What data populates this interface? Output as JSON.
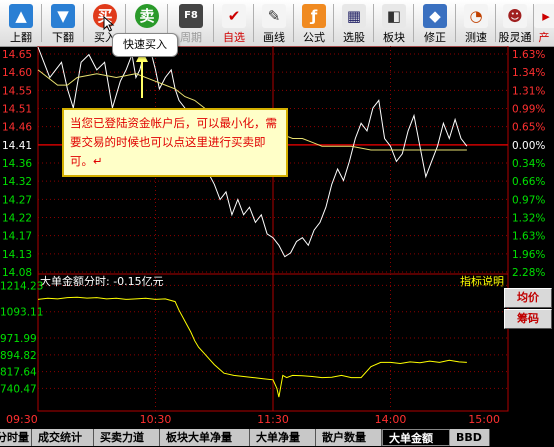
{
  "toolbar": {
    "buttons": [
      {
        "label": "上翻",
        "icon": "arrow-up-icon"
      },
      {
        "label": "下翻",
        "icon": "arrow-down-icon"
      },
      {
        "label": "买入",
        "icon": "buy-icon",
        "glyph": "买"
      },
      {
        "label": "",
        "icon": "sell-icon",
        "glyph": "卖"
      },
      {
        "label": "周期",
        "icon": "period-icon",
        "glyph": "F8"
      },
      {
        "label": "自选",
        "icon": "watchlist-icon"
      },
      {
        "label": "画线",
        "icon": "draw-line-icon"
      },
      {
        "label": "公式",
        "icon": "formula-icon"
      },
      {
        "label": "选股",
        "icon": "stock-picker-icon"
      },
      {
        "label": "板块",
        "icon": "sector-icon"
      },
      {
        "label": "修正",
        "icon": "revise-icon"
      },
      {
        "label": "测速",
        "icon": "speed-test-icon"
      },
      {
        "label": "股灵通",
        "icon": "gulingtong-icon"
      },
      {
        "label": "产",
        "icon": "more-icon"
      }
    ],
    "tooltip": "快速买入"
  },
  "note": {
    "text": "当您已登陆资金帐户后，可以最小化，需要交易的时候也可以点这里进行买卖即可。↵"
  },
  "lower_panel": {
    "title": "大单金额分时: -0.15亿元",
    "indicator_button": "指标说明",
    "side_buttons": [
      "均价",
      "筹码"
    ]
  },
  "tabs": [
    "分时量",
    "成交统计",
    "买卖力道",
    "板块大单净量",
    "大单净量",
    "散户数量",
    "大单金额",
    "BBD"
  ],
  "active_tab": 6,
  "colors": {
    "price_line": "#ffffff",
    "avg_line": "#e8e070",
    "lower_line": "#ffff00",
    "up": "#ff3030",
    "down": "#00e000",
    "grid": "#8b0000"
  },
  "chart_data": [
    {
      "type": "line",
      "title": "",
      "x_ticks": [
        "09:30",
        "10:30",
        "11:30",
        "14:00",
        "15:00"
      ],
      "xlim": [
        0,
        240
      ],
      "ylim": [
        14.07,
        14.66
      ],
      "prev_close": 14.41,
      "y_ticks_left": [
        "14.65",
        "14.60",
        "14.55",
        "14.51",
        "14.46",
        "14.41",
        "14.36",
        "14.32",
        "14.27",
        "14.22",
        "14.17",
        "14.13",
        "14.08"
      ],
      "y_ticks_right": [
        "1.63%",
        "1.34%",
        "1.31%",
        "0.99%",
        "0.65%",
        "0.00%",
        "0.34%",
        "0.66%",
        "0.97%",
        "1.32%",
        "1.63%",
        "1.96%",
        "2.28%"
      ],
      "series": [
        {
          "role": "price",
          "x": [
            0,
            3,
            6,
            9,
            12,
            15,
            18,
            22,
            26,
            30,
            34,
            38,
            42,
            45,
            48,
            50,
            52,
            55,
            58,
            60,
            62,
            65,
            68,
            70,
            72,
            75,
            78,
            80,
            82,
            85,
            88,
            90,
            93,
            96,
            99,
            102,
            105,
            108,
            111,
            114,
            117,
            120,
            123,
            126,
            129,
            132,
            135,
            138,
            141,
            144,
            147,
            150,
            153,
            156,
            159,
            162,
            165,
            168,
            171,
            174,
            177,
            180,
            183,
            186,
            189,
            192,
            195,
            198,
            201,
            204,
            207,
            210,
            213,
            216,
            219
          ],
          "values": [
            14.66,
            14.62,
            14.58,
            14.6,
            14.62,
            14.55,
            14.5,
            14.62,
            14.64,
            14.6,
            14.62,
            14.5,
            14.57,
            14.6,
            14.64,
            14.58,
            14.6,
            14.66,
            14.64,
            14.6,
            14.55,
            14.58,
            14.6,
            14.55,
            14.52,
            14.5,
            14.48,
            14.46,
            14.42,
            14.36,
            14.32,
            14.3,
            14.26,
            14.28,
            14.22,
            14.26,
            14.22,
            14.24,
            14.2,
            14.22,
            14.17,
            14.16,
            14.14,
            14.11,
            14.12,
            14.15,
            14.16,
            14.14,
            14.18,
            14.2,
            14.24,
            14.3,
            14.34,
            14.31,
            14.36,
            14.42,
            14.46,
            14.44,
            14.5,
            14.52,
            14.42,
            14.4,
            14.36,
            14.38,
            14.44,
            14.48,
            14.4,
            14.32,
            14.36,
            14.4,
            14.46,
            14.42,
            14.47,
            14.42,
            14.4
          ]
        },
        {
          "role": "average",
          "x": [
            0,
            5,
            10,
            15,
            20,
            30,
            40,
            50,
            60,
            65,
            70,
            75,
            80,
            85,
            90,
            95,
            100,
            105,
            110,
            115,
            120,
            125,
            130,
            135,
            140,
            145,
            150,
            160,
            170,
            180,
            190,
            200,
            210,
            219
          ],
          "values": [
            14.6,
            14.58,
            14.56,
            14.56,
            14.58,
            14.59,
            14.58,
            14.59,
            14.57,
            14.56,
            14.55,
            14.53,
            14.52,
            14.5,
            14.48,
            14.47,
            14.46,
            14.46,
            14.45,
            14.44,
            14.44,
            14.43,
            14.42,
            14.42,
            14.41,
            14.4,
            14.4,
            14.4,
            14.39,
            14.39,
            14.39,
            14.39,
            14.39,
            14.39
          ]
        }
      ]
    },
    {
      "type": "line",
      "title": "大单金额分时: -0.15亿元",
      "xlim": [
        0,
        240
      ],
      "ylim": [
        650,
        1230
      ],
      "y_ticks": [
        "1214.23",
        "1093.11",
        "971.99",
        "894.82",
        "817.64",
        "740.47"
      ],
      "series": [
        {
          "role": "big-order-amount",
          "x": [
            0,
            5,
            10,
            15,
            20,
            25,
            30,
            35,
            40,
            45,
            50,
            55,
            60,
            65,
            70,
            72,
            75,
            78,
            80,
            82,
            85,
            88,
            90,
            95,
            100,
            105,
            110,
            115,
            120,
            122,
            123,
            124,
            125,
            127,
            130,
            135,
            140,
            145,
            150,
            155,
            160,
            165,
            170,
            175,
            180,
            185,
            190,
            195,
            200,
            205,
            210,
            215,
            219
          ],
          "values": [
            1150,
            1155,
            1152,
            1158,
            1160,
            1156,
            1158,
            1152,
            1155,
            1150,
            1152,
            1155,
            1150,
            1152,
            1140,
            1100,
            1050,
            1000,
            960,
            930,
            900,
            870,
            850,
            810,
            800,
            795,
            790,
            785,
            780,
            740,
            700,
            750,
            800,
            790,
            800,
            798,
            795,
            790,
            792,
            800,
            790,
            790,
            840,
            860,
            860,
            855,
            862,
            858,
            866,
            860,
            870,
            862,
            860
          ]
        }
      ]
    }
  ]
}
